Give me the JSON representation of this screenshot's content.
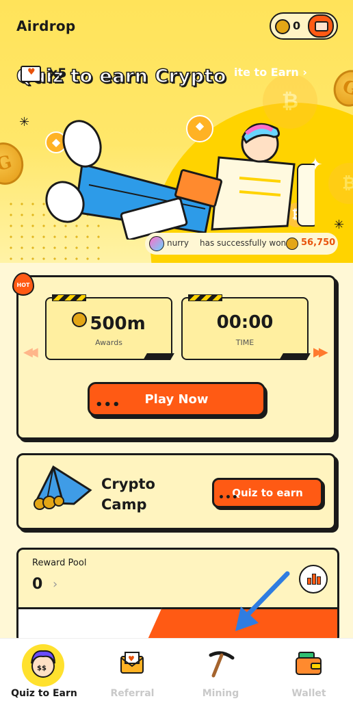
{
  "header": {
    "title": "Airdrop",
    "balance": "0"
  },
  "hero": {
    "title": "Quiz to earn Crypto",
    "winner": {
      "user": "nurry",
      "message": "has successfully won",
      "amount": "56,750"
    }
  },
  "quiz_card": {
    "badge": "HOT",
    "awards_value": "500m",
    "awards_label": "Awards",
    "time_value": "00:00",
    "time_label": "TIME",
    "play_label": "Play Now"
  },
  "camp_card": {
    "title": "Crypto Camp",
    "button_label": "Quiz to earn"
  },
  "reward_pool": {
    "label": "Reward Pool",
    "value": "0",
    "multiplier": "x5",
    "invite_label": "ite to Earn ›"
  },
  "nav": [
    {
      "label": "Quiz to Earn",
      "icon": "quiz-avatar-icon",
      "active": true
    },
    {
      "label": "Referral",
      "icon": "referral-mail-icon",
      "active": false
    },
    {
      "label": "Mining",
      "icon": "pickaxe-icon",
      "active": false
    },
    {
      "label": "Wallet",
      "icon": "wallet-icon",
      "active": false
    }
  ],
  "colors": {
    "accent": "#ff5a14",
    "hero_bg": "#ffe35a",
    "card_bg": "#fff4bf",
    "annotation_arrow": "#2f7de1"
  }
}
